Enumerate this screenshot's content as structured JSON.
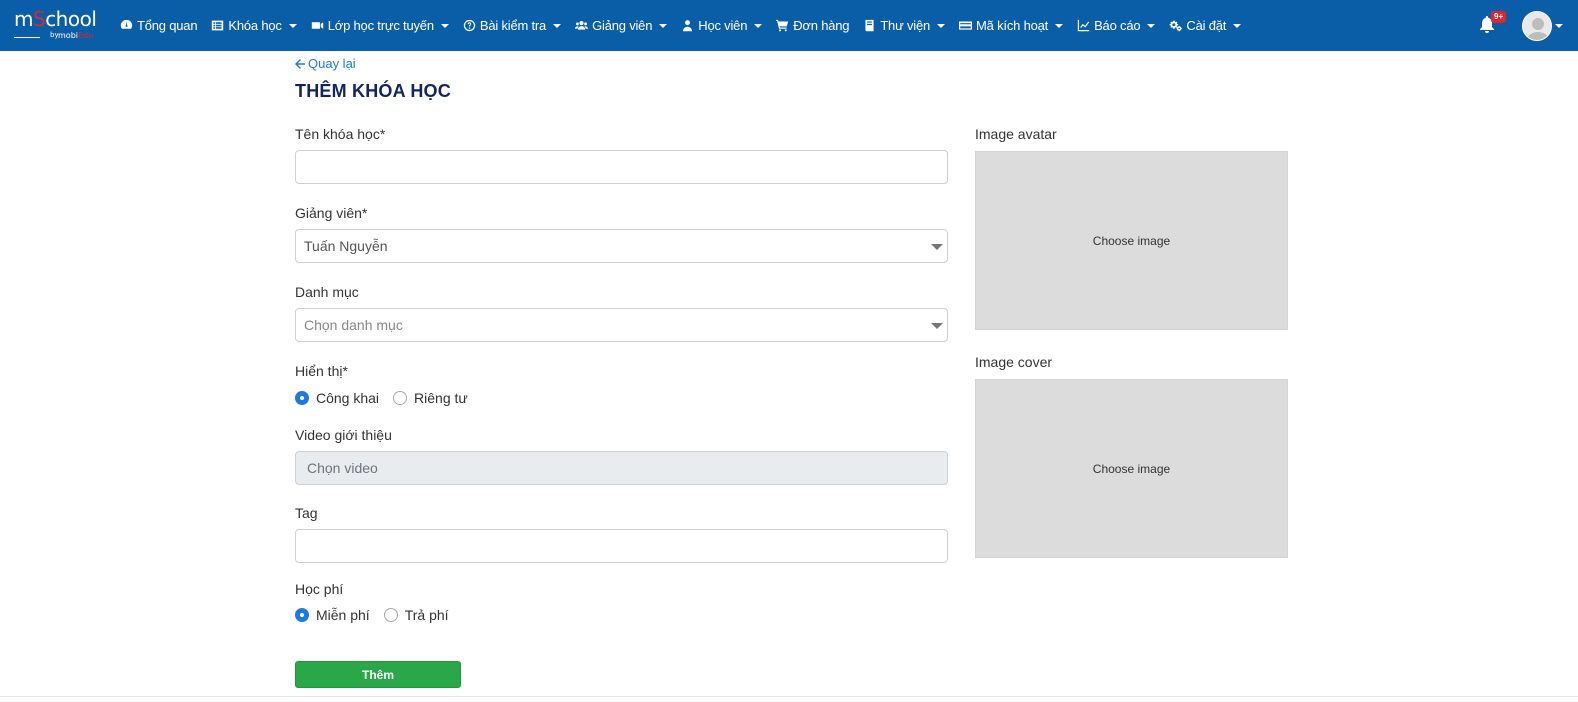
{
  "brand": {
    "logo_prefix": "m",
    "logo_accent": "S",
    "logo_suffix": "chool",
    "logo_by": "by",
    "logo_mobi": "mobi",
    "logo_edu": "Edu"
  },
  "navbar": {
    "items": [
      {
        "label": "Tổng quan",
        "icon": "dashboard-icon",
        "dropdown": false
      },
      {
        "label": "Khóa học",
        "icon": "list-icon",
        "dropdown": true
      },
      {
        "label": "Lớp học trực tuyến",
        "icon": "video-camera-icon",
        "dropdown": true
      },
      {
        "label": "Bài kiểm tra",
        "icon": "question-circle-icon",
        "dropdown": true
      },
      {
        "label": "Giảng viên",
        "icon": "users-icon",
        "dropdown": true
      },
      {
        "label": "Học viên",
        "icon": "user-icon",
        "dropdown": true
      },
      {
        "label": "Đơn hàng",
        "icon": "shopping-cart-icon",
        "dropdown": false
      },
      {
        "label": "Thư viện",
        "icon": "book-icon",
        "dropdown": true
      },
      {
        "label": "Mã kích hoạt",
        "icon": "credit-card-icon",
        "dropdown": true
      },
      {
        "label": "Báo cáo",
        "icon": "chart-icon",
        "dropdown": true
      },
      {
        "label": "Cài đặt",
        "icon": "cogs-icon",
        "dropdown": true
      }
    ],
    "notification_badge": "9+"
  },
  "page": {
    "back_label": "Quay lại",
    "title": "THÊM KHÓA HỌC"
  },
  "form": {
    "course_name_label": "Tên khóa học*",
    "course_name_value": "",
    "instructor_label": "Giảng viên*",
    "instructor_value": "Tuấn Nguyễn",
    "category_label": "Danh mục",
    "category_placeholder": "Chọn danh mục",
    "visibility_label": "Hiển thị*",
    "visibility_options": [
      "Công khai",
      "Riêng tư"
    ],
    "visibility_selected": "Công khai",
    "video_label": "Video giới thiệu",
    "video_placeholder": "Chọn video",
    "tag_label": "Tag",
    "tag_value": "",
    "fee_label": "Học phí",
    "fee_options": [
      "Miễn phí",
      "Trả phí"
    ],
    "fee_selected": "Miễn phí",
    "submit_label": "Thêm"
  },
  "images": {
    "avatar_label": "Image avatar",
    "avatar_button": "Choose image",
    "cover_label": "Image cover",
    "cover_button": "Choose image"
  },
  "colors": {
    "navbar_bg": "#0a5ea8",
    "title": "#12265c",
    "link": "#1f7ae0",
    "submit_bg": "#2aa748",
    "image_placeholder_bg": "#dcdcdc"
  }
}
